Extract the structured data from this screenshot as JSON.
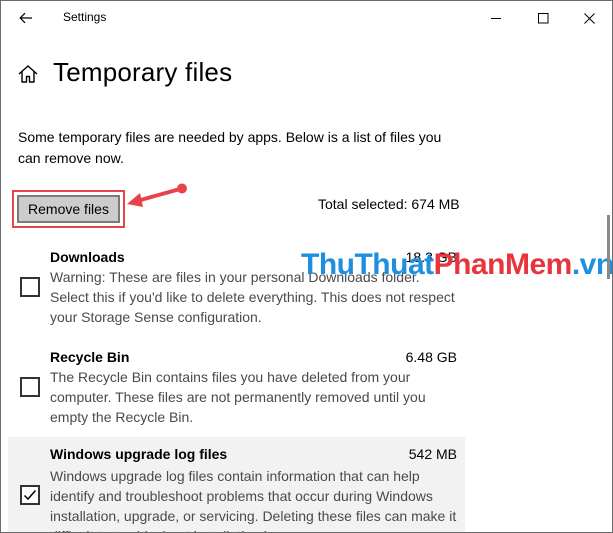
{
  "window": {
    "title": "Settings",
    "icons": {
      "back": "back-arrow-icon",
      "minimize": "minimize-icon",
      "maximize": "maximize-icon",
      "close": "close-icon"
    }
  },
  "page": {
    "title": "Temporary files",
    "home_icon": "home-icon",
    "intro": "Some temporary files are needed by apps. Below is a list of files you can remove now."
  },
  "actions": {
    "remove_label": "Remove files",
    "total_selected": "Total selected: 674 MB",
    "highlight_color": "#e8434a"
  },
  "items": [
    {
      "name": "Downloads",
      "size": "18.3 GB",
      "checked": false,
      "description": "Warning: These are files in your personal Downloads folder. Select this if you'd like to delete everything. This does not respect your Storage Sense configuration."
    },
    {
      "name": "Recycle Bin",
      "size": "6.48 GB",
      "checked": false,
      "description": "The Recycle Bin contains files you have deleted from your computer. These files are not permanently removed until you empty the Recycle Bin."
    },
    {
      "name": "Windows upgrade log files",
      "size": "542 MB",
      "checked": true,
      "description": "Windows upgrade log files contain information that can help identify and troubleshoot problems that occur during Windows installation, upgrade, or servicing.  Deleting these files can make it difficult to troubleshoot installation issues."
    }
  ],
  "watermark": {
    "part1": "ThuThuat",
    "part2": "PhanMem",
    "part3": ".vn"
  }
}
